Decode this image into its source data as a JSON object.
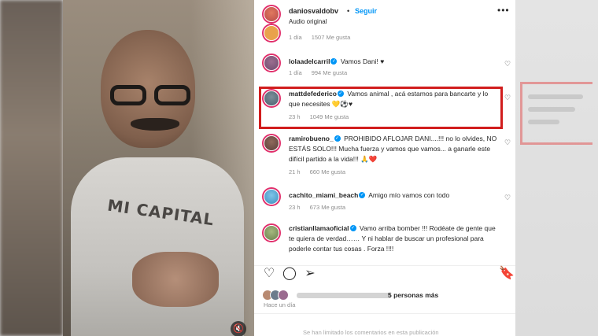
{
  "header": {
    "username": "daniosvaldobv",
    "separator": "•",
    "follow_label": "Seguir",
    "audio_label": "Audio original",
    "more_icon": "more-icon"
  },
  "video": {
    "shirt_text": "MI CAPITAL",
    "mute_icon": "mute-icon"
  },
  "comments": [
    {
      "username": "",
      "text": "",
      "time": "1 día",
      "likes": "1507 Me gusta",
      "verified": false,
      "avatar_color": "#e9a24b"
    },
    {
      "username": "lolaadelcarril",
      "text": "Vamos Dani! ♥",
      "time": "1 día",
      "likes": "994 Me gusta",
      "verified": true,
      "avatar_color": "#6e4c6f"
    },
    {
      "username": "mattdefederico",
      "text": "Vamos animal , acá estamos para bancarte y lo que necesites 💛⚽♥",
      "time": "23 h",
      "likes": "1049 Me gusta",
      "verified": true,
      "avatar_color": "#4a5f6e"
    },
    {
      "username": "ramirobueno_",
      "text": "PROHIBIDO AFLOJAR DANI....!!! no lo olvides, NO ESTÁS SOLO!!! Mucha fuerza y vamos que vamos... a ganarle este difícil partido a la vida!!! 🙏❤️",
      "time": "21 h",
      "likes": "660 Me gusta",
      "verified": true,
      "avatar_color": "#5b3f3a"
    },
    {
      "username": "cachito_miami_beach",
      "text": "Amigo mío vamos con todo",
      "time": "23 h",
      "likes": "673 Me gusta",
      "verified": true,
      "avatar_color": "#3f8fbf"
    },
    {
      "username": "cristianllamaoficial",
      "text": "Vamo arriba bomber !!! Rodéate de gente que te quiera de verdad…… Y ni hablar de buscar un profesional para poderle contar tus cosas . Forza !!!!",
      "time": "",
      "likes": "",
      "verified": true,
      "avatar_color": "#6a7f4d"
    }
  ],
  "actions": {
    "like_icon": "heart-icon",
    "comment_icon": "comment-icon",
    "share_icon": "share-icon",
    "save_icon": "bookmark-icon"
  },
  "likes_summary": "5 personas más",
  "posted_time": "Hace un día",
  "footer_text": "Se han limitado los comentarios en esta publicación",
  "colors": {
    "follow": "#0095f6",
    "highlight": "#d11d1d",
    "verified": "#0095f6"
  }
}
